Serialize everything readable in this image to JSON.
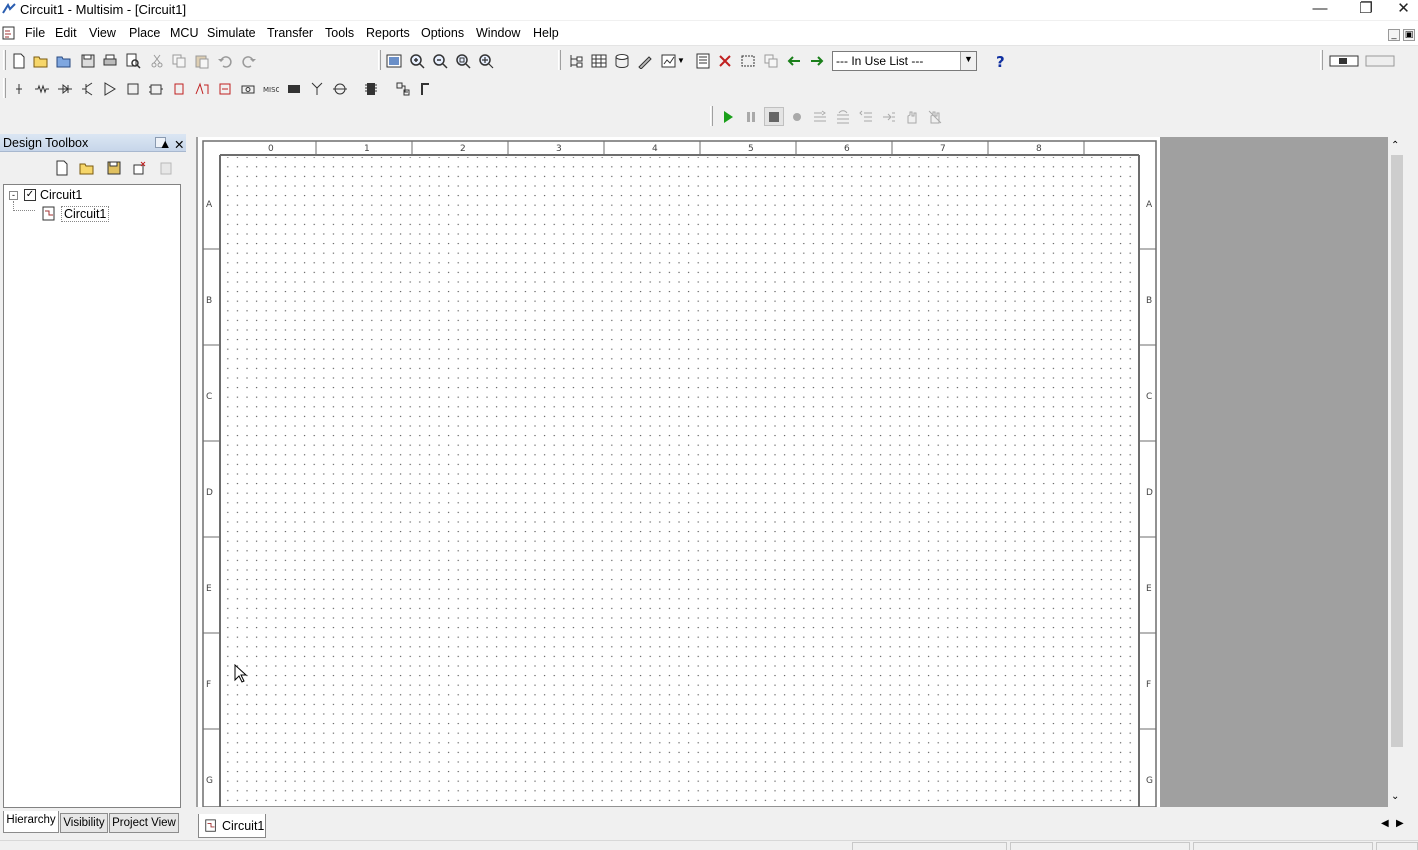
{
  "window": {
    "title": "Circuit1 - Multisim - [Circuit1]",
    "minimize_icon": "minimize-icon",
    "restore_icon": "restore-icon",
    "close_icon": "close-icon"
  },
  "menu": [
    "File",
    "Edit",
    "View",
    "Place",
    "MCU",
    "Simulate",
    "Transfer",
    "Tools",
    "Reports",
    "Options",
    "Window",
    "Help"
  ],
  "toolbar": {
    "in_use_list": "--- In Use List ---"
  },
  "design_toolbox": {
    "title": "Design Toolbox",
    "tree": [
      {
        "label": "Circuit1",
        "level": 0,
        "checked": true
      },
      {
        "label": "Circuit1",
        "level": 1
      }
    ],
    "tabs": [
      "Hierarchy",
      "Visibility",
      "Project View"
    ],
    "active_tab": "Hierarchy"
  },
  "sheet": {
    "columns": [
      "0",
      "1",
      "2",
      "3",
      "4",
      "5",
      "6",
      "7",
      "8"
    ],
    "rows": [
      "A",
      "B",
      "C",
      "D",
      "E",
      "F",
      "G"
    ]
  },
  "document_tabs": [
    "Circuit1"
  ],
  "colors": {
    "accent": "#1a7f1a",
    "sheet_border": "#6e6e6e",
    "workspace": "#a0a0a0"
  }
}
